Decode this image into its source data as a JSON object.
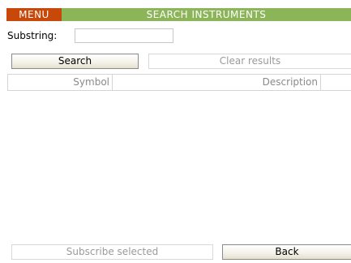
{
  "header": {
    "menu_label": "MENU",
    "title": "SEARCH INSTRUMENTS"
  },
  "search": {
    "substring_label": "Substring:",
    "substring_value": "",
    "search_label": "Search",
    "clear_label": "Clear results"
  },
  "table": {
    "columns": [
      "Symbol",
      "Description"
    ],
    "rows": []
  },
  "footer": {
    "subscribe_label": "Subscribe selected",
    "back_label": "Back"
  },
  "colors": {
    "title_bar": "#8cb55a",
    "menu_button": "#c8480a"
  }
}
